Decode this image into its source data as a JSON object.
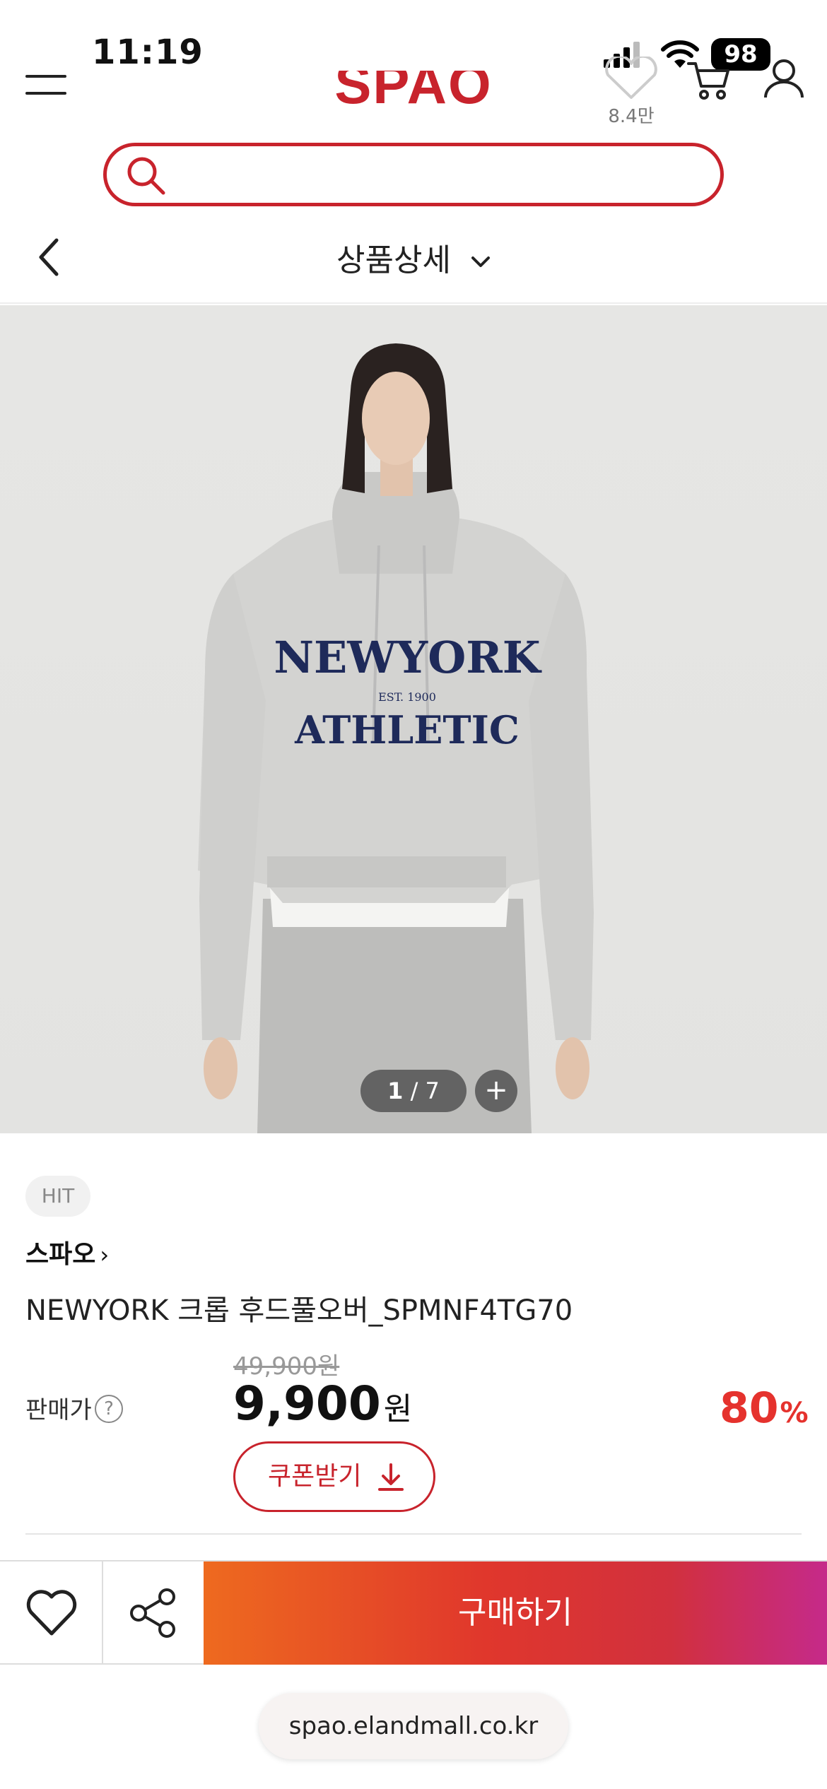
{
  "status_bar": {
    "time": "11:19",
    "battery": "98"
  },
  "header": {
    "wish_count": "8.4만",
    "logo_text": "SPAO"
  },
  "search": {
    "placeholder": ""
  },
  "subheader": {
    "title": "상품상세"
  },
  "gallery": {
    "current": "1",
    "total": "/ 7",
    "zoom_symbol": "+"
  },
  "product": {
    "badge": "HIT",
    "brand": "스파오",
    "brand_arrow": "›",
    "name": "NEWYORK 크롭 후드풀오버_SPMNF4TG70",
    "original_price": "49,900원",
    "price_label": "판매가",
    "help_symbol": "?",
    "price": "9,900",
    "currency": "원",
    "discount": "80",
    "discount_unit": "%",
    "coupon_label": "쿠폰받기"
  },
  "actions": {
    "buy_label": "구매하기"
  },
  "browser": {
    "url": "spao.elandmall.co.kr"
  },
  "colors": {
    "brand_red": "#c8232c",
    "discount_red": "#e5322d",
    "buy_gradient_start": "#ee6a1f",
    "buy_gradient_end": "#c52a8a"
  }
}
